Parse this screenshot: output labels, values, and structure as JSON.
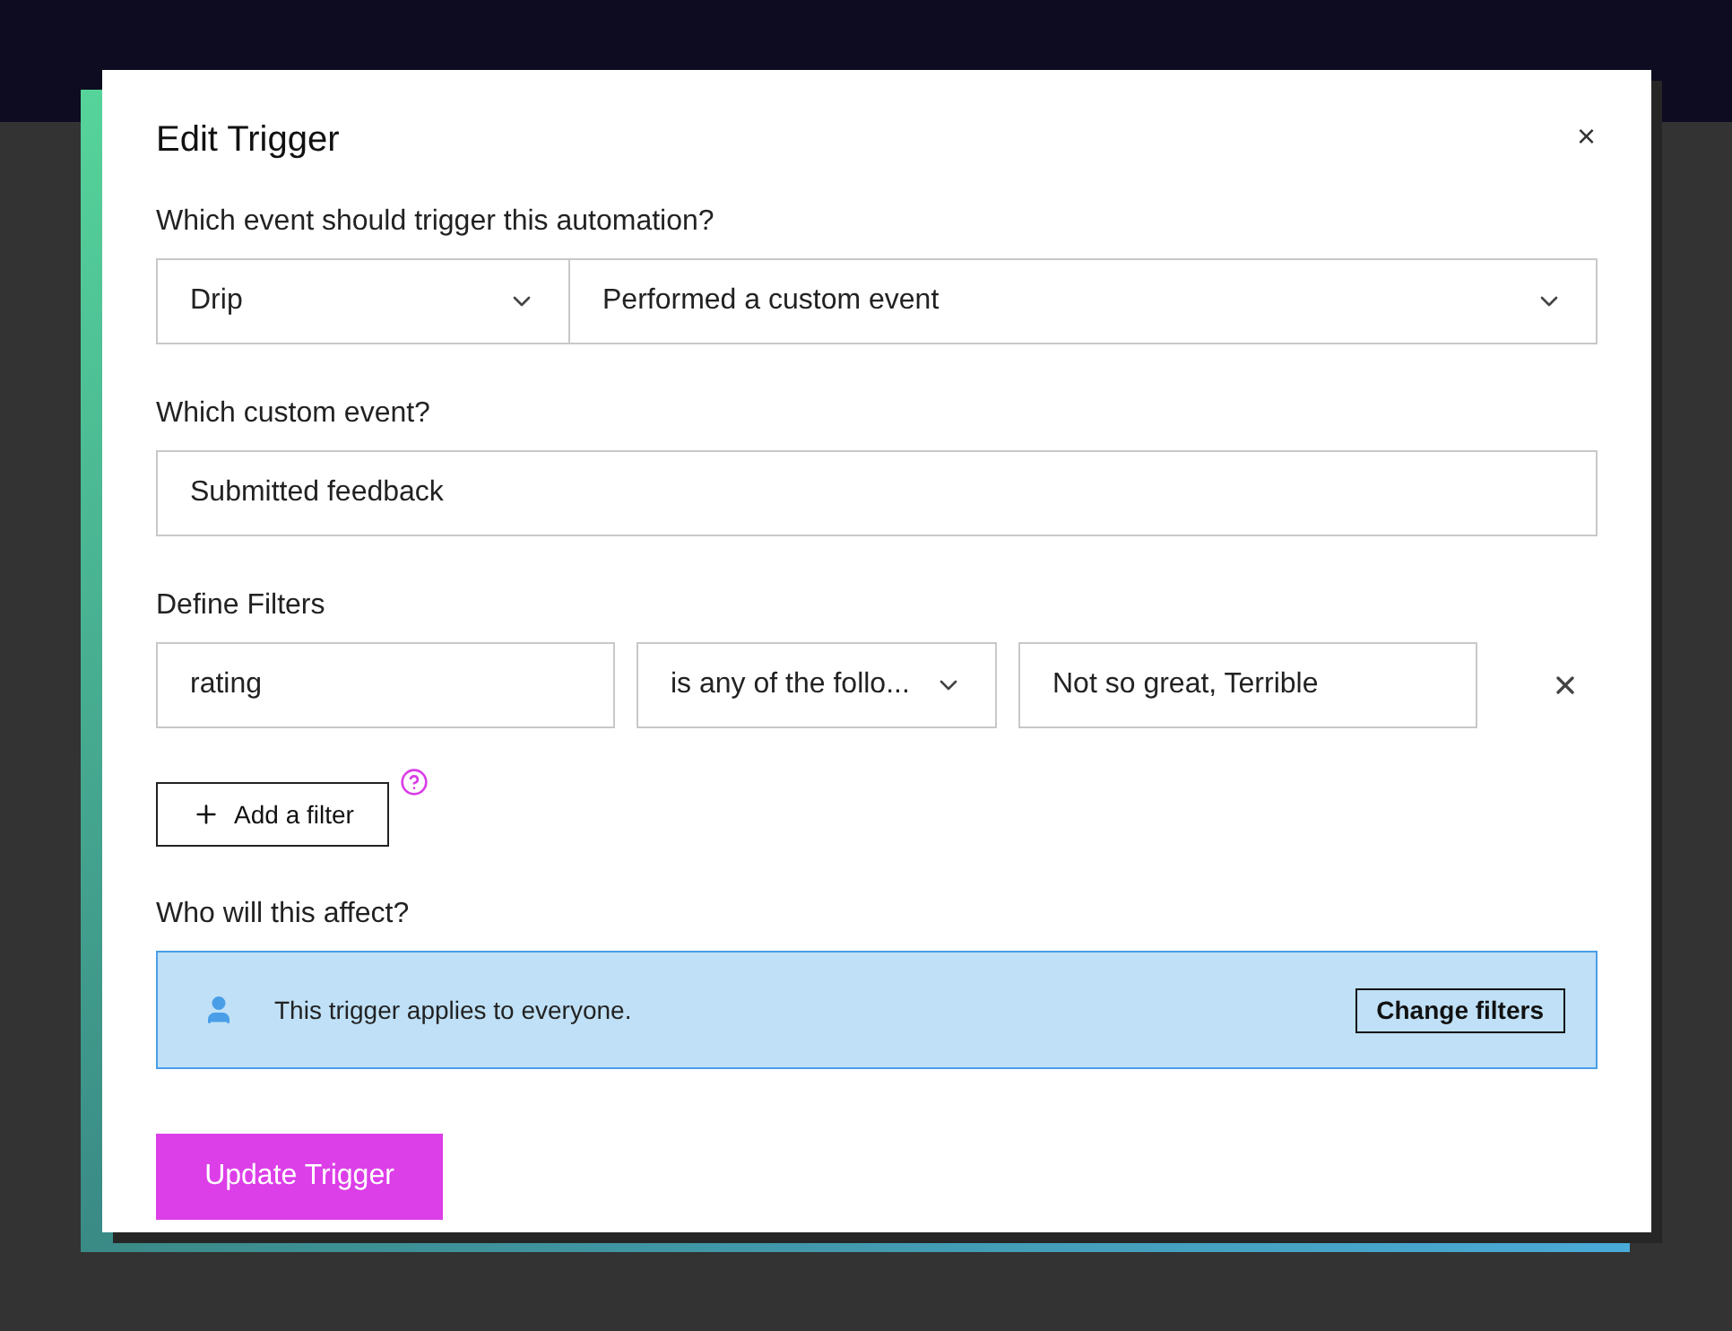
{
  "dialog": {
    "title": "Edit Trigger",
    "close": "×"
  },
  "event": {
    "label": "Which event should trigger this automation?",
    "provider": "Drip",
    "action": "Performed a custom event"
  },
  "custom_event": {
    "label": "Which custom event?",
    "value": "Submitted feedback"
  },
  "filters": {
    "label": "Define Filters",
    "rows": [
      {
        "property": "rating",
        "operator": "is any of the follo...",
        "value": "Not so great, Terrible"
      }
    ],
    "add_button": "Add a filter"
  },
  "audience": {
    "label": "Who will this affect?",
    "notice": "This trigger applies to everyone.",
    "change_button": "Change filters"
  },
  "submit": "Update Trigger"
}
